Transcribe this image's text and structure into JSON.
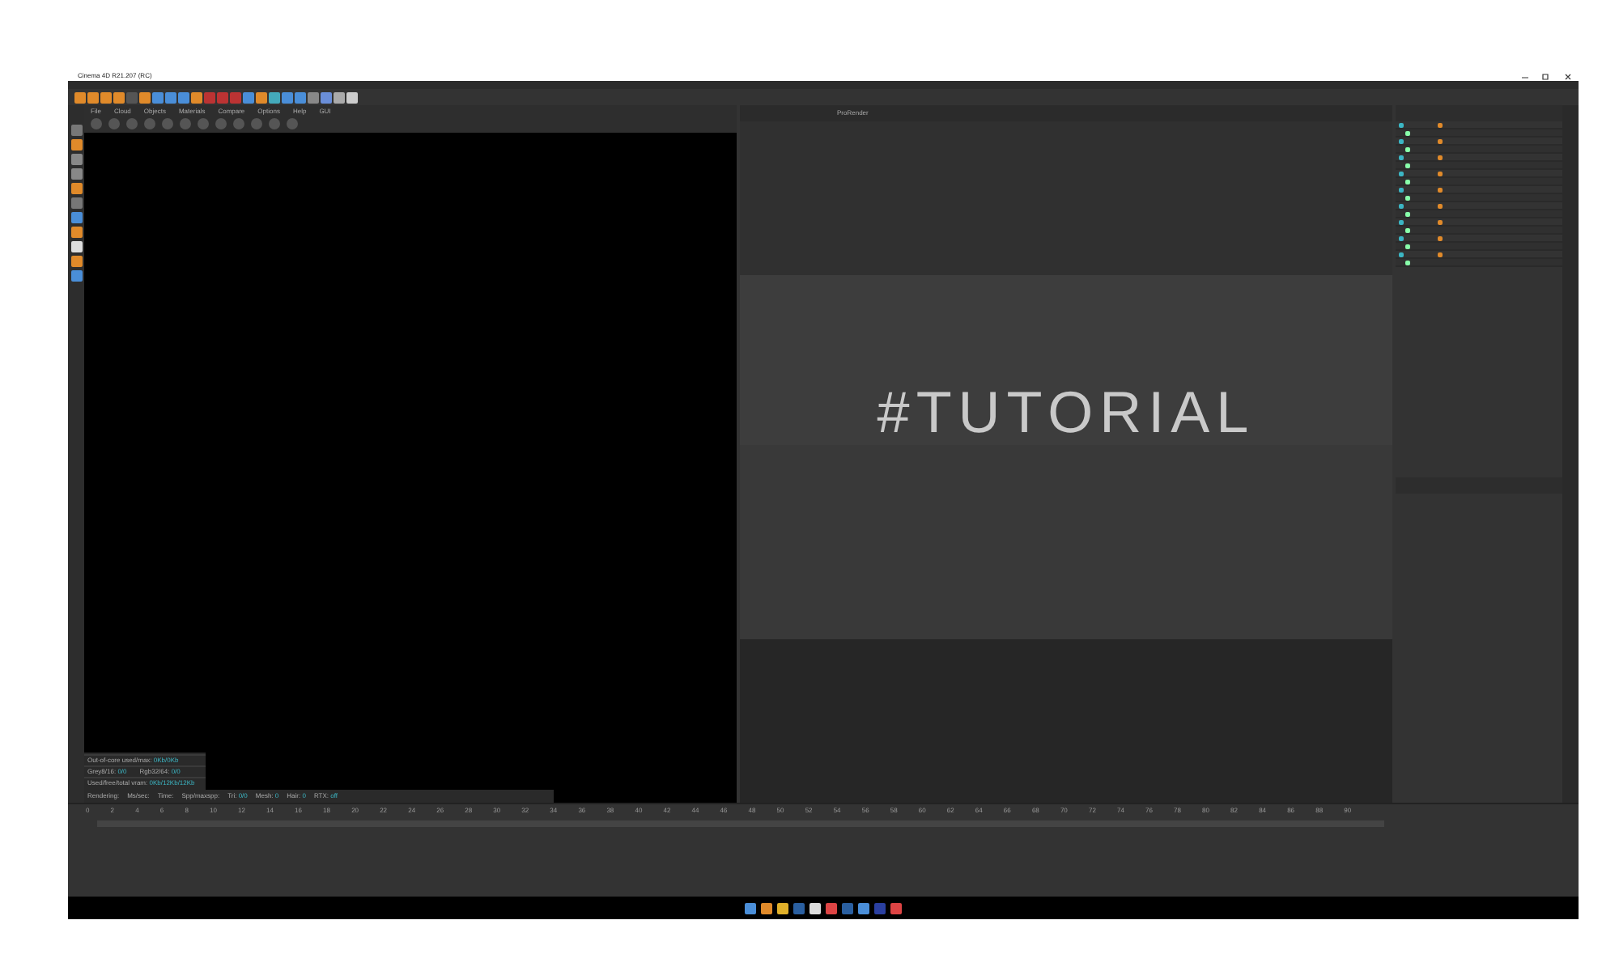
{
  "window": {
    "title": "Cinema 4D R21.207 (RC)"
  },
  "render_view": {
    "menus": [
      "File",
      "Cloud",
      "Objects",
      "Materials",
      "Compare",
      "Options",
      "Help",
      "GUI"
    ],
    "stats": [
      [
        {
          "label": "Out-of-core used/max:",
          "value": "0Kb/0Kb"
        }
      ],
      [
        {
          "label": "Grey8/16:",
          "value": "0/0"
        },
        {
          "label": "Rgb32/64:",
          "value": "0/0"
        }
      ],
      [
        {
          "label": "Used/free/total vram:",
          "value": "0Kb/12Kb/12Kb"
        }
      ]
    ],
    "status": [
      {
        "label": "Rendering:"
      },
      {
        "label": "Ms/sec:"
      },
      {
        "label": "Time:"
      },
      {
        "label": "Spp/maxspp:"
      },
      {
        "label": "Tri:",
        "value": "0/0"
      },
      {
        "label": "Mesh:",
        "value": "0"
      },
      {
        "label": "Hair:",
        "value": "0"
      },
      {
        "label": "RTX:",
        "value": "off"
      }
    ]
  },
  "viewport": {
    "menu": "ProRender",
    "scene_text": "#TUTORIAL"
  },
  "object_manager": {
    "rows": [
      {
        "kind": "parent"
      },
      {
        "kind": "child"
      },
      {
        "kind": "parent"
      },
      {
        "kind": "child"
      },
      {
        "kind": "parent"
      },
      {
        "kind": "child"
      },
      {
        "kind": "parent"
      },
      {
        "kind": "child"
      },
      {
        "kind": "parent"
      },
      {
        "kind": "child"
      },
      {
        "kind": "parent"
      },
      {
        "kind": "child"
      },
      {
        "kind": "parent"
      },
      {
        "kind": "child"
      },
      {
        "kind": "parent"
      },
      {
        "kind": "child"
      },
      {
        "kind": "parent"
      },
      {
        "kind": "child"
      }
    ]
  },
  "timeline": {
    "ticks": [
      "0",
      "2",
      "4",
      "6",
      "8",
      "10",
      "12",
      "14",
      "16",
      "18",
      "20",
      "22",
      "24",
      "26",
      "28",
      "30",
      "32",
      "34",
      "36",
      "38",
      "40",
      "42",
      "44",
      "46",
      "48",
      "50",
      "52",
      "54",
      "56",
      "58",
      "60",
      "62",
      "64",
      "66",
      "68",
      "70",
      "72",
      "74",
      "76",
      "78",
      "80",
      "82",
      "84",
      "86",
      "88",
      "90"
    ]
  }
}
